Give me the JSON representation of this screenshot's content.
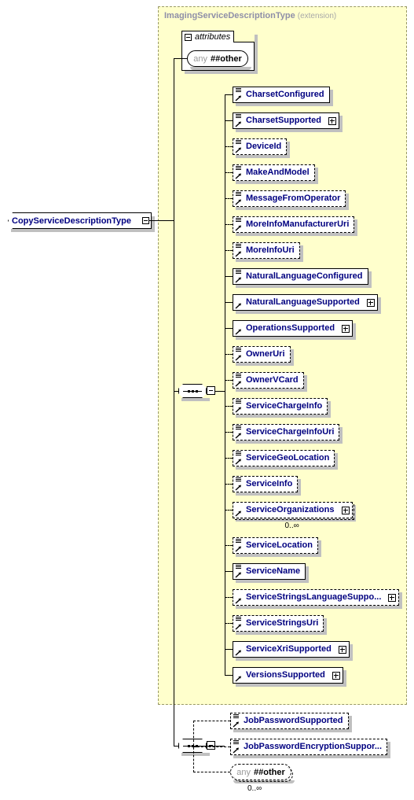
{
  "diagram": {
    "kind": "xsd-schema-diagram",
    "root": {
      "label": "CopyServiceDescriptionType",
      "collapse_icon": "minus-box-icon"
    },
    "extension": {
      "title": "ImagingServiceDescriptionType",
      "qualifier": "(extension)",
      "attributes_group": {
        "label": "attributes",
        "collapse_icon": "minus-box-icon",
        "items": [
          {
            "keyword": "any",
            "namespace": "##other",
            "style": "solid"
          }
        ]
      },
      "sequence": {
        "compositor_icon": "sequence-icon",
        "collapse_icon": "minus-box-icon",
        "elements": [
          {
            "label": "CharsetConfigured",
            "style": "solid",
            "icon": "element-icon",
            "plus": false,
            "cardinality": ""
          },
          {
            "label": "CharsetSupported",
            "style": "solid",
            "icon": "element-icon",
            "plus": true,
            "cardinality": ""
          },
          {
            "label": "DeviceId",
            "style": "dashed",
            "icon": "element-icon",
            "plus": false,
            "cardinality": ""
          },
          {
            "label": "MakeAndModel",
            "style": "dashed",
            "icon": "element-icon",
            "plus": false,
            "cardinality": ""
          },
          {
            "label": "MessageFromOperator",
            "style": "dashed",
            "icon": "element-icon",
            "plus": false,
            "cardinality": ""
          },
          {
            "label": "MoreInfoManufacturerUri",
            "style": "dashed",
            "icon": "element-icon",
            "plus": false,
            "cardinality": ""
          },
          {
            "label": "MoreInfoUri",
            "style": "dashed",
            "icon": "element-icon",
            "plus": false,
            "cardinality": ""
          },
          {
            "label": "NaturalLanguageConfigured",
            "style": "solid",
            "icon": "element-icon",
            "plus": false,
            "cardinality": ""
          },
          {
            "label": "NaturalLanguageSupported",
            "style": "solid",
            "icon": "element-plain-icon",
            "plus": true,
            "cardinality": ""
          },
          {
            "label": "OperationsSupported",
            "style": "solid",
            "icon": "element-plain-icon",
            "plus": true,
            "cardinality": ""
          },
          {
            "label": "OwnerUri",
            "style": "dashed",
            "icon": "element-icon",
            "plus": false,
            "cardinality": ""
          },
          {
            "label": "OwnerVCard",
            "style": "dashed",
            "icon": "element-icon",
            "plus": false,
            "cardinality": ""
          },
          {
            "label": "ServiceChargeInfo",
            "style": "dashed",
            "icon": "element-icon",
            "plus": false,
            "cardinality": ""
          },
          {
            "label": "ServiceChargeInfoUri",
            "style": "dashed",
            "icon": "element-icon",
            "plus": false,
            "cardinality": ""
          },
          {
            "label": "ServiceGeoLocation",
            "style": "dashed",
            "icon": "element-icon",
            "plus": false,
            "cardinality": ""
          },
          {
            "label": "ServiceInfo",
            "style": "dashed",
            "icon": "element-icon",
            "plus": false,
            "cardinality": ""
          },
          {
            "label": "ServiceOrganizations",
            "style": "dashed",
            "icon": "element-plain-icon",
            "plus": true,
            "cardinality": "0..∞"
          },
          {
            "label": "ServiceLocation",
            "style": "dashed",
            "icon": "element-icon",
            "plus": false,
            "cardinality": ""
          },
          {
            "label": "ServiceName",
            "style": "solid",
            "icon": "element-icon",
            "plus": false,
            "cardinality": ""
          },
          {
            "label": "ServiceStringsLanguageSuppo...",
            "style": "dashed",
            "icon": "element-plain-icon",
            "plus": true,
            "cardinality": ""
          },
          {
            "label": "ServiceStringsUri",
            "style": "dashed",
            "icon": "element-icon",
            "plus": false,
            "cardinality": ""
          },
          {
            "label": "ServiceXriSupported",
            "style": "solid",
            "icon": "element-plain-icon",
            "plus": true,
            "cardinality": ""
          },
          {
            "label": "VersionsSupported",
            "style": "solid",
            "icon": "element-plain-icon",
            "plus": true,
            "cardinality": ""
          }
        ]
      }
    },
    "outer_sequence": {
      "compositor_icon": "sequence-icon",
      "collapse_icon": "minus-box-icon",
      "elements": [
        {
          "label": "JobPasswordSupported",
          "style": "dashed",
          "icon": "element-icon",
          "plus": false,
          "cardinality": ""
        },
        {
          "label": "JobPasswordEncryptionSuppor...",
          "style": "dashed",
          "icon": "element-icon",
          "plus": false,
          "cardinality": ""
        }
      ],
      "any": {
        "keyword": "any",
        "namespace": "##other",
        "style": "dashed",
        "cardinality": "0..∞"
      }
    },
    "colors": {
      "extension_fill": "#ffffcc",
      "extension_border": "#999966",
      "node_text": "#000080",
      "title_text": "#8f8fa8",
      "shadow": "#c0c0c0"
    }
  }
}
